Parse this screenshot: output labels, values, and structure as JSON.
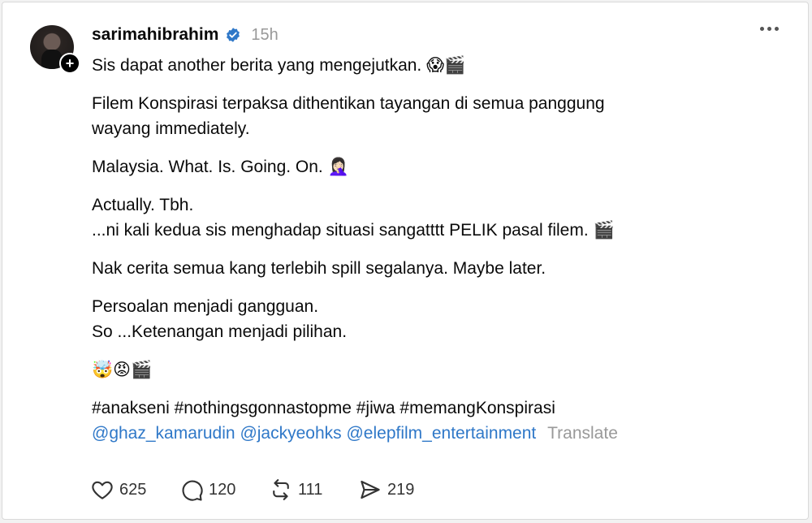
{
  "post": {
    "username": "sarimahibrahim",
    "timestamp": "15h",
    "lines": {
      "l1": "Sis dapat another berita yang mengejutkan. 😱🎬",
      "l2a": "Filem Konspirasi terpaksa dithentikan tayangan di semua panggung",
      "l2b": "wayang immediately.",
      "l3": "Malaysia. What. Is. Going. On. 🤦🏻‍♀️",
      "l4a": "Actually. Tbh.",
      "l4b": "...ni kali kedua sis menghadap situasi sangatttt PELIK pasal filem. 🎬",
      "l5": "Nak cerita semua kang terlebih spill segalanya. Maybe later.",
      "l6a": "Persoalan menjadi gangguan.",
      "l6b": "So ...Ketenangan menjadi pilihan.",
      "l7": "🤯😡🎬"
    },
    "hashtags": "#anakseni #nothingsgonnastopme #jiwa #memangKonspirasi",
    "mentions": [
      "@ghaz_kamarudin",
      "@jackyeohks",
      "@elepfilm_entertainment"
    ],
    "translate_label": "Translate"
  },
  "actions": {
    "likes": "625",
    "replies": "120",
    "reposts": "111",
    "shares": "219"
  },
  "colors": {
    "mention": "#2f78c8",
    "verified": "#2f78c8",
    "muted": "#999999"
  }
}
